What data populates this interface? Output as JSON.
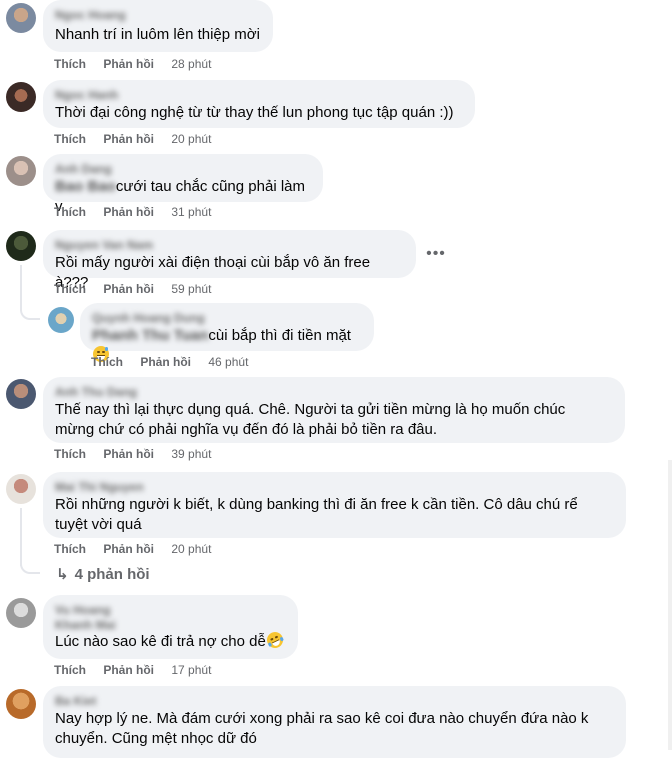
{
  "labels": {
    "like": "Thích",
    "reply": "Phản hồi"
  },
  "comments": [
    {
      "name": "Ngoc Hoang",
      "text": "Nhanh trí in luôm lên thiệp mời",
      "time": "28 phút"
    },
    {
      "name": "Ngoc Hanh",
      "text": "Thời đại công nghệ từ từ thay thế lun phong tục tập quán :))",
      "time": "20 phút"
    },
    {
      "name": "Anh Dang",
      "mention": "Bao Bao",
      "text": "cưới tau chắc cũng phải làm v",
      "time": "31 phút"
    },
    {
      "name": "Nguyen Van Nam",
      "text": "Rồi mấy người xài điện thoại cùi bắp vô ăn free à???",
      "time": "59 phút",
      "more_icon": "more-horizontal-icon"
    },
    {
      "name": "Quynh Hoang Dung",
      "mention": "Phanh Thu Tuan",
      "text": "cùi bắp thì đi tiền mặt",
      "emoji": "grinning-sweat-emoji",
      "time": "46 phút"
    },
    {
      "name": "Anh Thu Dang",
      "line1": "Thế nay thì lại thực dụng quá. Chê. Người ta gửi tiền mừng là họ muốn chúc",
      "line2": "mừng chứ có phải nghĩa vụ đến đó là phải bỏ tiền ra đâu.",
      "time": "39 phút"
    },
    {
      "name": "Mai Thi Nguyen",
      "line1": "Rồi những người k biết, k dùng banking thì đi ăn free k cần tiền. Cô dâu chú rể",
      "line2": "tuyệt vời quá",
      "time": "20 phút",
      "view_replies": "4 phản hồi"
    },
    {
      "name": "Vu Hoang",
      "name2": "Khanh Mai",
      "text": "Lúc nào sao kê đi trả nợ cho dễ",
      "emoji": "rofl-emoji",
      "time": "17 phút"
    },
    {
      "name": "Ba Kiet",
      "line1": "Nay hợp lý ne. Mà đám cưới xong phải ra sao kê coi đưa nào chuyển đứa nào k",
      "line2": "chuyển. Cũng mệt nhọc dữ đó"
    }
  ]
}
